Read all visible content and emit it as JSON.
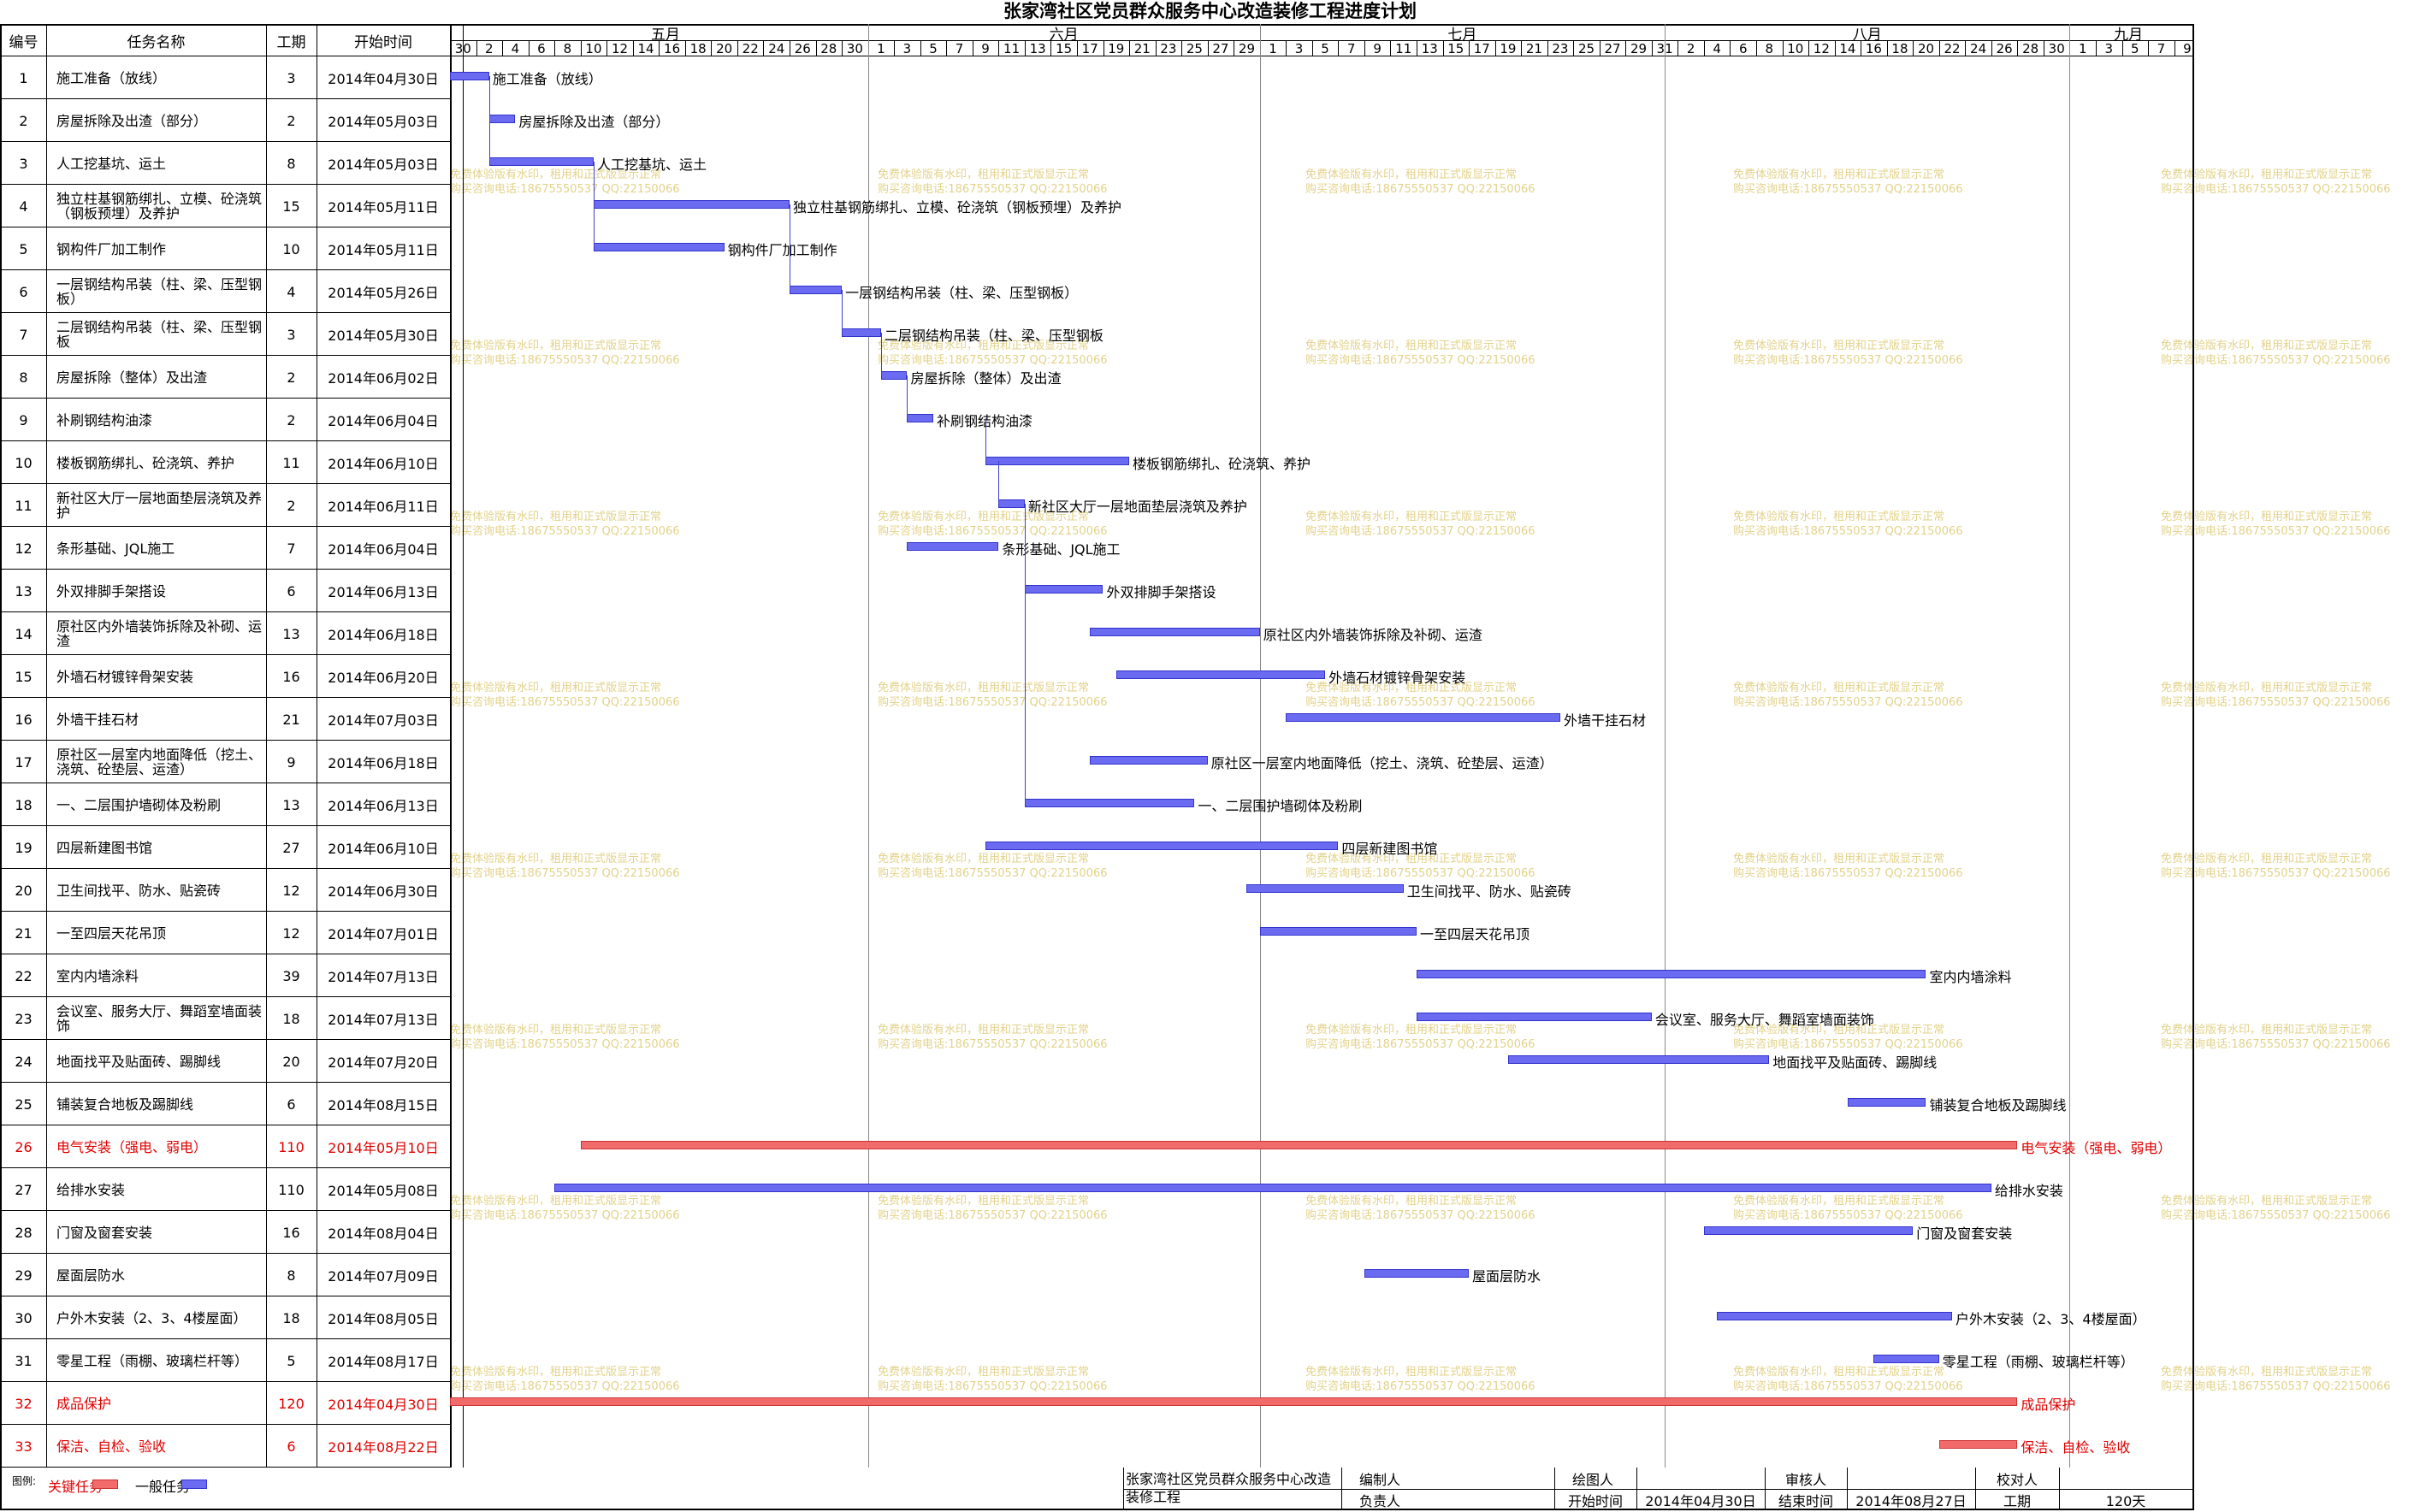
{
  "title": "张家湾社区党员群众服务中心改造装修工程进度计划",
  "headers": {
    "id": "编号",
    "name": "任务名称",
    "dur": "工期",
    "start": "开始时间"
  },
  "months": [
    "五月",
    "六月",
    "七月",
    "八月",
    "九月"
  ],
  "days": [
    "30",
    "2",
    "4",
    "6",
    "8",
    "10",
    "12",
    "14",
    "16",
    "18",
    "20",
    "22",
    "24",
    "26",
    "28",
    "30",
    "1",
    "3",
    "5",
    "7",
    "9",
    "11",
    "13",
    "15",
    "17",
    "19",
    "21",
    "23",
    "25",
    "27",
    "29",
    "1",
    "3",
    "5",
    "7",
    "9",
    "11",
    "13",
    "15",
    "17",
    "19",
    "21",
    "23",
    "25",
    "27",
    "29",
    "31",
    "2",
    "4",
    "6",
    "8",
    "10",
    "12",
    "14",
    "16",
    "18",
    "20",
    "22",
    "24",
    "26",
    "28",
    "30",
    "1",
    "3",
    "5",
    "7",
    "9"
  ],
  "tasks": [
    {
      "id": "1",
      "name": "施工准备（放线）",
      "dur": "3",
      "start": "2014年04月30日",
      "offset": 0,
      "crit": false,
      "label": "施工准备（放线）"
    },
    {
      "id": "2",
      "name": "房屋拆除及出渣（部分）",
      "dur": "2",
      "start": "2014年05月03日",
      "offset": 3,
      "crit": false,
      "label": "房屋拆除及出渣（部分）"
    },
    {
      "id": "3",
      "name": "人工挖基坑、运土",
      "dur": "8",
      "start": "2014年05月03日",
      "offset": 3,
      "crit": false,
      "label": "人工挖基坑、运土"
    },
    {
      "id": "4",
      "name": "独立柱基钢筋绑扎、立模、砼浇筑（钢板预埋）及养护",
      "dur": "15",
      "start": "2014年05月11日",
      "offset": 11,
      "crit": false,
      "label": "独立柱基钢筋绑扎、立模、砼浇筑（钢板预埋）及养护"
    },
    {
      "id": "5",
      "name": "钢构件厂加工制作",
      "dur": "10",
      "start": "2014年05月11日",
      "offset": 11,
      "crit": false,
      "label": "钢构件厂加工制作"
    },
    {
      "id": "6",
      "name": "一层钢结构吊装（柱、梁、压型钢板）",
      "dur": "4",
      "start": "2014年05月26日",
      "offset": 26,
      "crit": false,
      "label": "一层钢结构吊装（柱、梁、压型钢板）"
    },
    {
      "id": "7",
      "name": "二层钢结构吊装（柱、梁、压型钢板",
      "dur": "3",
      "start": "2014年05月30日",
      "offset": 30,
      "crit": false,
      "label": "二层钢结构吊装（柱、梁、压型钢板"
    },
    {
      "id": "8",
      "name": "房屋拆除（整体）及出渣",
      "dur": "2",
      "start": "2014年06月02日",
      "offset": 33,
      "crit": false,
      "label": "房屋拆除（整体）及出渣"
    },
    {
      "id": "9",
      "name": "补刷钢结构油漆",
      "dur": "2",
      "start": "2014年06月04日",
      "offset": 35,
      "crit": false,
      "label": "补刷钢结构油漆"
    },
    {
      "id": "10",
      "name": "楼板钢筋绑扎、砼浇筑、养护",
      "dur": "11",
      "start": "2014年06月10日",
      "offset": 41,
      "crit": false,
      "label": "楼板钢筋绑扎、砼浇筑、养护"
    },
    {
      "id": "11",
      "name": "新社区大厅一层地面垫层浇筑及养护",
      "dur": "2",
      "start": "2014年06月11日",
      "offset": 42,
      "crit": false,
      "label": "新社区大厅一层地面垫层浇筑及养护"
    },
    {
      "id": "12",
      "name": "条形基础、JQL施工",
      "dur": "7",
      "start": "2014年06月04日",
      "offset": 35,
      "crit": false,
      "label": "条形基础、JQL施工"
    },
    {
      "id": "13",
      "name": "外双排脚手架搭设",
      "dur": "6",
      "start": "2014年06月13日",
      "offset": 44,
      "crit": false,
      "label": "外双排脚手架搭设"
    },
    {
      "id": "14",
      "name": "原社区内外墙装饰拆除及补砌、运渣",
      "dur": "13",
      "start": "2014年06月18日",
      "offset": 49,
      "crit": false,
      "label": "原社区内外墙装饰拆除及补砌、运渣"
    },
    {
      "id": "15",
      "name": "外墙石材镀锌骨架安装",
      "dur": "16",
      "start": "2014年06月20日",
      "offset": 51,
      "crit": false,
      "label": "外墙石材镀锌骨架安装"
    },
    {
      "id": "16",
      "name": "外墙干挂石材",
      "dur": "21",
      "start": "2014年07月03日",
      "offset": 64,
      "crit": false,
      "label": "外墙干挂石材"
    },
    {
      "id": "17",
      "name": "原社区一层室内地面降低（挖土、浇筑、砼垫层、运渣）",
      "dur": "9",
      "start": "2014年06月18日",
      "offset": 49,
      "crit": false,
      "label": "原社区一层室内地面降低（挖土、浇筑、砼垫层、运渣）"
    },
    {
      "id": "18",
      "name": "一、二层围护墙砌体及粉刷",
      "dur": "13",
      "start": "2014年06月13日",
      "offset": 44,
      "crit": false,
      "label": "一、二层围护墙砌体及粉刷"
    },
    {
      "id": "19",
      "name": "四层新建图书馆",
      "dur": "27",
      "start": "2014年06月10日",
      "offset": 41,
      "crit": false,
      "label": "四层新建图书馆"
    },
    {
      "id": "20",
      "name": "卫生间找平、防水、贴瓷砖",
      "dur": "12",
      "start": "2014年06月30日",
      "offset": 61,
      "crit": false,
      "label": "卫生间找平、防水、贴瓷砖"
    },
    {
      "id": "21",
      "name": "一至四层天花吊顶",
      "dur": "12",
      "start": "2014年07月01日",
      "offset": 62,
      "crit": false,
      "label": "一至四层天花吊顶"
    },
    {
      "id": "22",
      "name": "室内内墙涂料",
      "dur": "39",
      "start": "2014年07月13日",
      "offset": 74,
      "crit": false,
      "label": "室内内墙涂料"
    },
    {
      "id": "23",
      "name": "会议室、服务大厅、舞蹈室墙面装饰",
      "dur": "18",
      "start": "2014年07月13日",
      "offset": 74,
      "crit": false,
      "label": "会议室、服务大厅、舞蹈室墙面装饰"
    },
    {
      "id": "24",
      "name": "地面找平及贴面砖、踢脚线",
      "dur": "20",
      "start": "2014年07月20日",
      "offset": 81,
      "crit": false,
      "label": "地面找平及贴面砖、踢脚线"
    },
    {
      "id": "25",
      "name": "铺装复合地板及踢脚线",
      "dur": "6",
      "start": "2014年08月15日",
      "offset": 107,
      "crit": false,
      "label": "铺装复合地板及踢脚线"
    },
    {
      "id": "26",
      "name": "电气安装（强电、弱电）",
      "dur": "110",
      "start": "2014年05月10日",
      "offset": 10,
      "crit": true,
      "label": "电气安装（强电、弱电）"
    },
    {
      "id": "27",
      "name": "给排水安装",
      "dur": "110",
      "start": "2014年05月08日",
      "offset": 8,
      "crit": false,
      "label": "给排水安装"
    },
    {
      "id": "28",
      "name": "门窗及窗套安装",
      "dur": "16",
      "start": "2014年08月04日",
      "offset": 96,
      "crit": false,
      "label": "门窗及窗套安装"
    },
    {
      "id": "29",
      "name": "屋面层防水",
      "dur": "8",
      "start": "2014年07月09日",
      "offset": 70,
      "crit": false,
      "label": "屋面层防水"
    },
    {
      "id": "30",
      "name": "户外木安装（2、3、4楼屋面）",
      "dur": "18",
      "start": "2014年08月05日",
      "offset": 97,
      "crit": false,
      "label": "户外木安装（2、3、4楼屋面）"
    },
    {
      "id": "31",
      "name": "零星工程（雨棚、玻璃栏杆等）",
      "dur": "5",
      "start": "2014年08月17日",
      "offset": 109,
      "crit": false,
      "label": "零星工程（雨棚、玻璃栏杆等）"
    },
    {
      "id": "32",
      "name": "成品保护",
      "dur": "120",
      "start": "2014年04月30日",
      "offset": 0,
      "crit": true,
      "label": "成品保护"
    },
    {
      "id": "33",
      "name": "保洁、自检、验收",
      "dur": "6",
      "start": "2014年08月22日",
      "offset": 114,
      "crit": true,
      "label": "保洁、自检、验收"
    }
  ],
  "legend": {
    "title": "图例:",
    "critical": "关键任务",
    "normal": "一般任务"
  },
  "footer": {
    "project": "张家湾社区党员群众服务中心改造装修工程",
    "compiler_label": "编制人",
    "drawer_label": "绘图人",
    "reviewer_label": "审核人",
    "checker_label": "校对人",
    "owner_label": "负责人",
    "start_label": "开始时间",
    "start_value": "2014年04月30日",
    "end_label": "结束时间",
    "end_value": "2014年08月27日",
    "duration_label": "工期",
    "duration_value": "120天"
  },
  "watermark": {
    "line1": "免费体验版有水印，租用和正式版显示正常",
    "line2": "购买咨询电话:18675550537 QQ:22150066"
  },
  "colors": {
    "normal": "#6b6bf2",
    "critical": "#f26b6b",
    "critical_text": "#e00000",
    "grid": "#9a9a9a",
    "watermark": "#e2d28a"
  }
}
